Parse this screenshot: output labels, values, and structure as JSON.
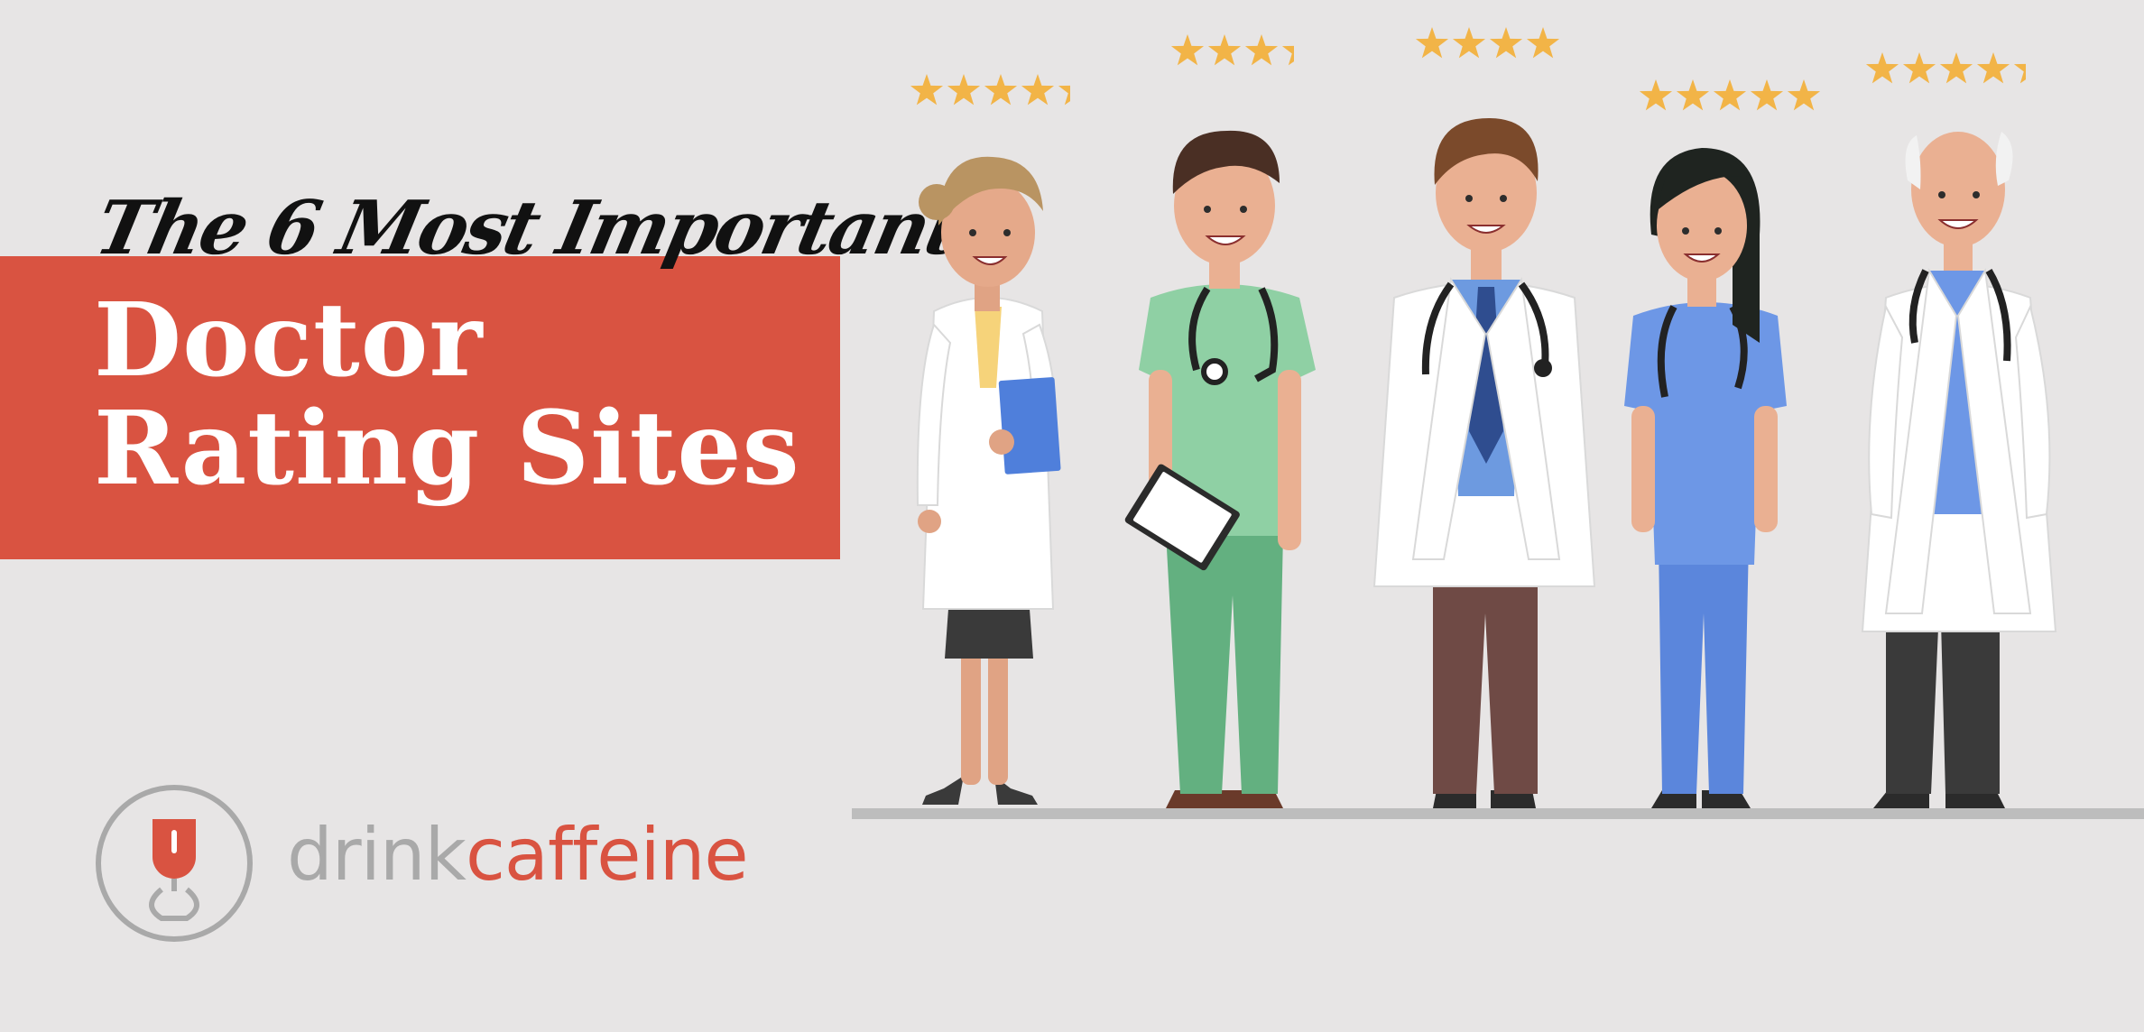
{
  "title": {
    "kicker": "The 6 Most Important",
    "line1": "Doctor",
    "line2": "Rating Sites"
  },
  "logo": {
    "part1": "drink",
    "part2": "caffeine",
    "icon": "coffee-cup-icon"
  },
  "colors": {
    "background": "#e7e5e5",
    "banner": "#d95341",
    "star": "#f2b447",
    "floor": "#bdbdbd"
  },
  "illustration": {
    "doctors": [
      {
        "label": "female-doctor-blonde",
        "stars": 4.5
      },
      {
        "label": "male-doctor-green-scrubs",
        "stars": 3.5
      },
      {
        "label": "male-doctor-tie",
        "stars": 4
      },
      {
        "label": "female-doctor-blue-scrubs",
        "stars": 5
      },
      {
        "label": "senior-male-doctor",
        "stars": 4.5
      }
    ]
  }
}
